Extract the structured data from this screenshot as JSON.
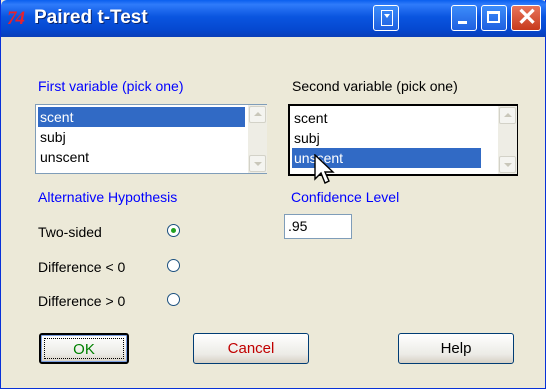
{
  "window": {
    "title": "Paired t-Test",
    "app_icon_text": "74"
  },
  "first_variable": {
    "label": "First variable (pick one)",
    "items": [
      "scent",
      "subj",
      "unscent"
    ],
    "selected": "scent"
  },
  "second_variable": {
    "label": "Second variable (pick one)",
    "items": [
      "scent",
      "subj",
      "unscent"
    ],
    "selected": "unscent"
  },
  "alternative": {
    "label": "Alternative Hypothesis",
    "options": [
      "Two-sided",
      "Difference < 0",
      "Difference > 0"
    ],
    "selected": "Two-sided"
  },
  "confidence": {
    "label": "Confidence Level",
    "value": ".95"
  },
  "buttons": {
    "ok": "OK",
    "cancel": "Cancel",
    "help": "Help"
  },
  "colors": {
    "titlebar": "#0A55E0",
    "selection": "#316AC5",
    "ok_text": "#008000",
    "cancel_text": "#C00000",
    "section_label": "#0000FF"
  }
}
